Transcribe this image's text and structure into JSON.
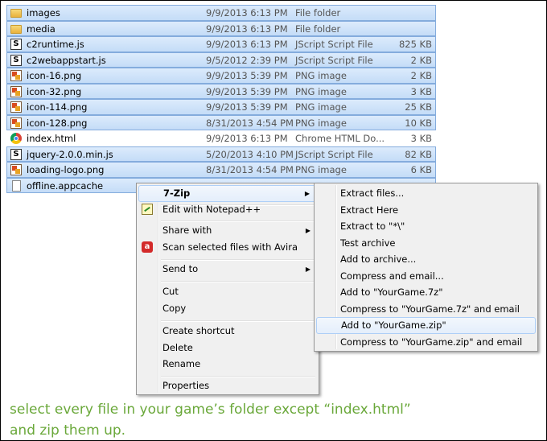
{
  "files": [
    {
      "name": "images",
      "date": "9/9/2013 6:13 PM",
      "type": "File folder",
      "size": "",
      "icon": "folder-icon",
      "selected": true
    },
    {
      "name": "media",
      "date": "9/9/2013 6:13 PM",
      "type": "File folder",
      "size": "",
      "icon": "folder-icon",
      "selected": true
    },
    {
      "name": "c2runtime.js",
      "date": "9/9/2013 6:13 PM",
      "type": "JScript Script File",
      "size": "825 KB",
      "icon": "script-icon",
      "selected": true
    },
    {
      "name": "c2webappstart.js",
      "date": "9/5/2012 2:39 PM",
      "type": "JScript Script File",
      "size": "2 KB",
      "icon": "script-icon",
      "selected": true
    },
    {
      "name": "icon-16.png",
      "date": "9/9/2013 5:39 PM",
      "type": "PNG image",
      "size": "2 KB",
      "icon": "png-image-icon",
      "selected": true
    },
    {
      "name": "icon-32.png",
      "date": "9/9/2013 5:39 PM",
      "type": "PNG image",
      "size": "3 KB",
      "icon": "png-image-icon",
      "selected": true
    },
    {
      "name": "icon-114.png",
      "date": "9/9/2013 5:39 PM",
      "type": "PNG image",
      "size": "25 KB",
      "icon": "png-image-icon",
      "selected": true
    },
    {
      "name": "icon-128.png",
      "date": "8/31/2013 4:54 PM",
      "type": "PNG image",
      "size": "10 KB",
      "icon": "png-image-icon",
      "selected": true
    },
    {
      "name": "index.html",
      "date": "9/9/2013 6:13 PM",
      "type": "Chrome HTML Do...",
      "size": "3 KB",
      "icon": "chrome-html-icon",
      "selected": false
    },
    {
      "name": "jquery-2.0.0.min.js",
      "date": "5/20/2013 4:10 PM",
      "type": "JScript Script File",
      "size": "82 KB",
      "icon": "script-icon",
      "selected": true
    },
    {
      "name": "loading-logo.png",
      "date": "8/31/2013 4:54 PM",
      "type": "PNG image",
      "size": "6 KB",
      "icon": "png-image-icon",
      "selected": true
    },
    {
      "name": "offline.appcache",
      "date": "",
      "type": "",
      "size": "",
      "icon": "document-icon",
      "selected": true
    }
  ],
  "context_menu": {
    "items": {
      "zip": "7-Zip",
      "notepad": "Edit with Notepad++",
      "share": "Share with",
      "avira": "Scan selected files with Avira",
      "send_to": "Send to",
      "cut": "Cut",
      "copy": "Copy",
      "create_shortcut": "Create shortcut",
      "delete": "Delete",
      "rename": "Rename",
      "properties": "Properties"
    },
    "submenu_arrow": "▶"
  },
  "zip_submenu": [
    "Extract files...",
    "Extract Here",
    "Extract to \"*\\\"",
    "Test archive",
    "Add to archive...",
    "Compress and email...",
    "Add to \"YourGame.7z\"",
    "Compress to \"YourGame.7z\" and email",
    "Add to \"YourGame.zip\"",
    "Compress to \"YourGame.zip\" and email"
  ],
  "zip_submenu_highlighted": "Add to \"YourGame.zip\"",
  "caption": {
    "line1": "select every file in your game’s folder except “index.html”",
    "line2": "and zip them up."
  },
  "colors": {
    "selection": "#cce0f8",
    "caption": "#6aa83a",
    "menu_bg": "#f0f0f0"
  }
}
